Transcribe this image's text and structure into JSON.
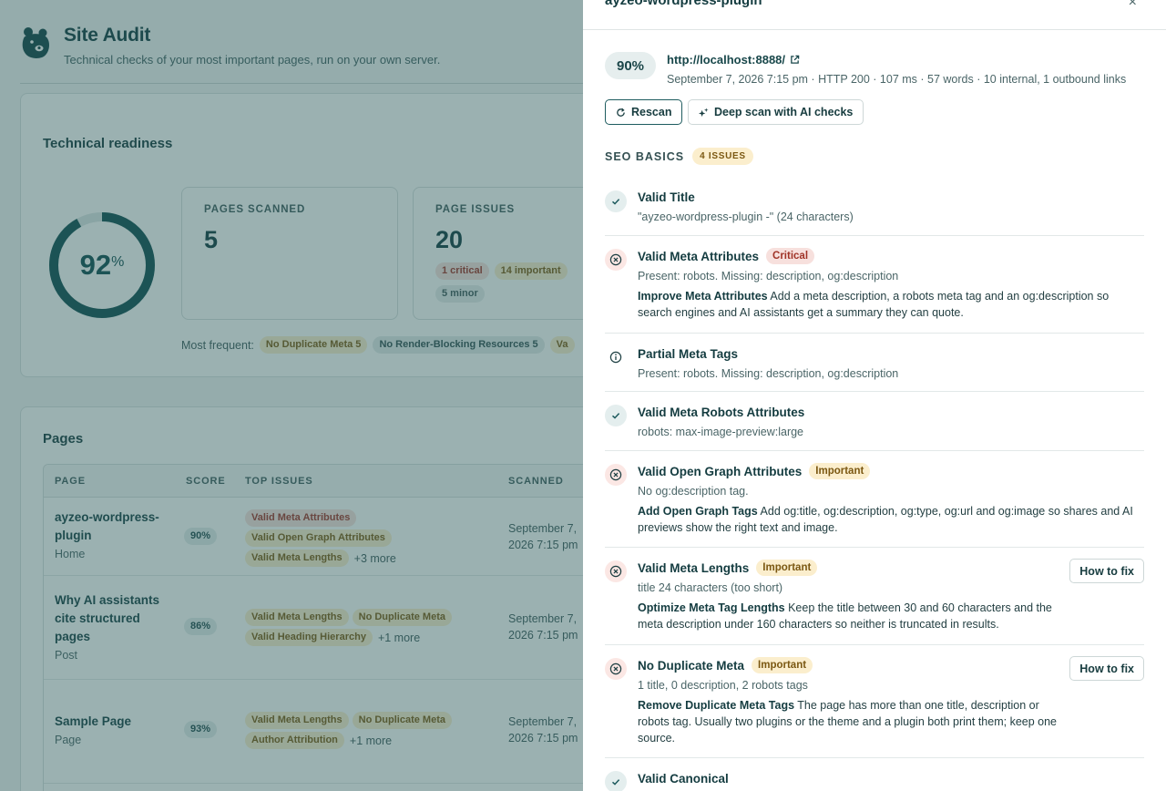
{
  "header": {
    "title": "Site Audit",
    "subtitle": "Technical checks of your most important pages, run on your own server."
  },
  "readiness": {
    "title": "Technical readiness",
    "score": "92",
    "score_unit": "%",
    "score_fraction": 0.92,
    "pages_scanned_label": "PAGES SCANNED",
    "pages_scanned": "5",
    "page_issues_label": "PAGE ISSUES",
    "page_issues": "20",
    "critical": "1 critical",
    "important": "14 important",
    "minor": "5 minor",
    "frequent_label": "Most frequent:",
    "frequent": [
      "No Duplicate Meta 5",
      "No Render-Blocking Resources 5",
      "Va"
    ]
  },
  "pages": {
    "title": "Pages",
    "columns": [
      "PAGE",
      "SCORE",
      "TOP ISSUES",
      "SCANNED"
    ],
    "rows": [
      {
        "name": "ayzeo-wordpress-plugin",
        "type": "Home",
        "score": "90%",
        "issues": [
          "Valid Meta Attributes",
          "Valid Open Graph Attributes",
          "Valid Meta Lengths"
        ],
        "more": "+3 more",
        "scanned": "September 7, 2026 7:15 pm"
      },
      {
        "name": "Why AI assistants cite structured pages",
        "type": "Post",
        "score": "86%",
        "issues": [
          "Valid Meta Lengths",
          "No Duplicate Meta",
          "Valid Heading Hierarchy"
        ],
        "more": "+1 more",
        "scanned": "September 7, 2026 7:15 pm"
      },
      {
        "name": "Sample Page",
        "type": "Page",
        "score": "93%",
        "issues": [
          "Valid Meta Lengths",
          "No Duplicate Meta",
          "Author Attribution"
        ],
        "more": "+1 more",
        "scanned": "September 7, 2026 7:15 pm"
      }
    ]
  },
  "drawer": {
    "title": "ayzeo-wordpress-plugin",
    "close_icon": "close-icon",
    "score": "90%",
    "url": "http://localhost:8888/",
    "meta": "September 7, 2026 7:15 pm · HTTP 200 · 107 ms · 57 words · 10 internal, 1 outbound links",
    "rescan_label": "Rescan",
    "deep_scan_label": "Deep scan with AI checks",
    "section_title": "SEO BASICS",
    "section_count": "4 ISSUES",
    "how_to_fix_label": "How to fix",
    "checks": [
      {
        "status": "pass",
        "name": "Valid Title",
        "badge": "",
        "detail": "\"ayzeo-wordpress-plugin -\" (24 characters)",
        "advice_title": "",
        "advice": ""
      },
      {
        "status": "fail",
        "name": "Valid Meta Attributes",
        "badge": "Critical",
        "detail": "Present: robots. Missing: description, og:description",
        "advice_title": "Improve Meta Attributes",
        "advice": "Add a meta description, a robots meta tag and an og:description so search engines and AI assistants get a summary they can quote."
      },
      {
        "status": "info",
        "name": "Partial Meta Tags",
        "badge": "",
        "detail": "Present: robots. Missing: description, og:description",
        "advice_title": "",
        "advice": ""
      },
      {
        "status": "pass",
        "name": "Valid Meta Robots Attributes",
        "badge": "",
        "detail": "robots: max-image-preview:large",
        "advice_title": "",
        "advice": ""
      },
      {
        "status": "fail",
        "name": "Valid Open Graph Attributes",
        "badge": "Important",
        "detail": "No og:description tag.",
        "advice_title": "Add Open Graph Tags",
        "advice": "Add og:title, og:description, og:type, og:url and og:image so shares and AI previews show the right text and image."
      },
      {
        "status": "fail",
        "name": "Valid Meta Lengths",
        "badge": "Important",
        "detail": "title 24 characters (too short)",
        "advice_title": "Optimize Meta Tag Lengths",
        "advice": "Keep the title between 30 and 60 characters and the meta description under 160 characters so neither is truncated in results."
      },
      {
        "status": "fail",
        "name": "No Duplicate Meta",
        "badge": "Important",
        "detail": "1 title, 0 description, 2 robots tags",
        "advice_title": "Remove Duplicate Meta Tags",
        "advice": "The page has more than one title, description or robots tag. Usually two plugins or the theme and a plugin both print them; keep one source."
      },
      {
        "status": "pass",
        "name": "Valid Canonical",
        "badge": "",
        "detail": "",
        "advice_title": "",
        "advice": ""
      }
    ]
  }
}
